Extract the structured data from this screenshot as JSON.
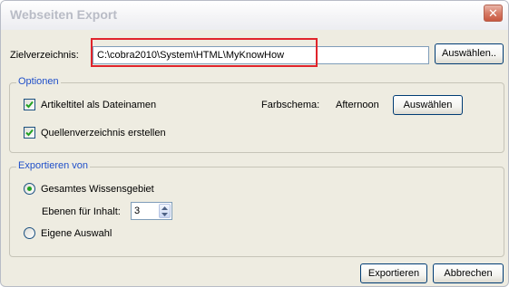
{
  "window": {
    "title": "Webseiten Export",
    "close_glyph": "✕"
  },
  "target": {
    "label": "Zielverzeichnis:",
    "path_value": "C:\\cobra2010\\System\\HTML\\MyKnowHow",
    "browse_button": "Auswählen..",
    "highlight_color": "#e0242b"
  },
  "options": {
    "legend": "Optionen",
    "article_titles_checkbox": {
      "label": "Artikeltitel als Dateinamen",
      "checked": true
    },
    "source_dir_checkbox": {
      "label": "Quellenverzeichnis erstellen",
      "checked": true
    },
    "color_scheme_label": "Farbschema:",
    "color_scheme_value": "Afternoon",
    "color_scheme_button": "Auswählen"
  },
  "export_from": {
    "legend": "Exportieren von",
    "whole_domain_radio": {
      "label": "Gesamtes Wissensgebiet",
      "selected": true
    },
    "levels_label": "Ebenen für Inhalt:",
    "levels_value": "3",
    "custom_selection_radio": {
      "label": "Eigene Auswahl",
      "selected": false
    }
  },
  "footer": {
    "export_button": "Exportieren",
    "cancel_button": "Abbrechen"
  },
  "colors": {
    "legend_blue": "#1f4fc9",
    "dialog_bg": "#eeece1",
    "checkmark_green": "#21a121"
  },
  "icons": {
    "close": "close-icon",
    "checkbox_mark": "checkmark-icon",
    "radio_dot": "radio-dot-icon",
    "spin_up": "arrow-up-icon",
    "spin_down": "arrow-down-icon"
  }
}
